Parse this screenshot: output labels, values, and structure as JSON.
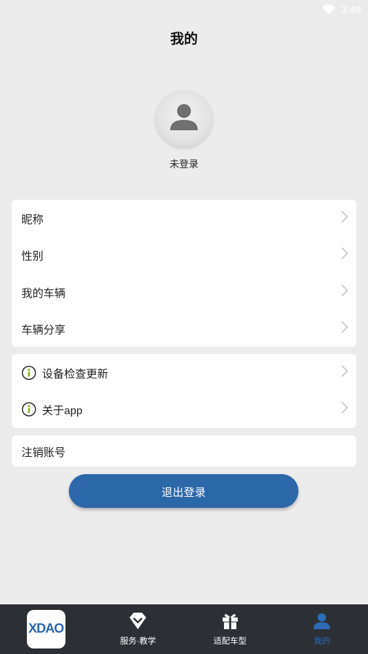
{
  "status_bar": {
    "time": "3:49",
    "icons": [
      "wifi-icon"
    ]
  },
  "header": {
    "title": "我的"
  },
  "profile": {
    "avatar_icon": "user-avatar-icon",
    "login_status": "未登录"
  },
  "profile_menu": {
    "items": [
      {
        "label": "昵称"
      },
      {
        "label": "性别"
      },
      {
        "label": "我的车辆"
      },
      {
        "label": "车辆分享"
      }
    ]
  },
  "app_menu": {
    "items": [
      {
        "label": "设备检查更新",
        "icon": "info-icon"
      },
      {
        "label": "关于app",
        "icon": "info-icon"
      }
    ]
  },
  "account": {
    "deregister_label": "注销账号"
  },
  "logout": {
    "label": "退出登录"
  },
  "bottom_nav": {
    "logo_text": "XDAO",
    "items": [
      {
        "label": "服务·教学",
        "icon": "diamond-chevron-icon",
        "active": false
      },
      {
        "label": "适配车型",
        "icon": "gift-icon",
        "active": false
      },
      {
        "label": "我的",
        "icon": "person-icon",
        "active": true
      }
    ]
  },
  "colors": {
    "accent": "#2c67a9",
    "nav_bg": "#2c2f34",
    "page_bg": "#ececec",
    "icon_green": "#8ab31f"
  }
}
